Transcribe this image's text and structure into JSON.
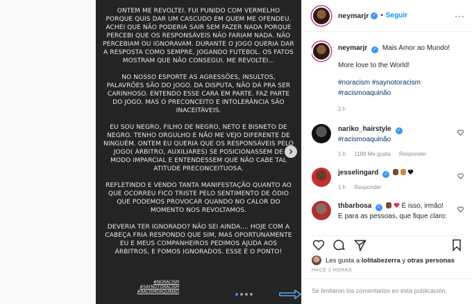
{
  "colors": {
    "accent": "#0095f6",
    "verified": "#3897f0",
    "tag": "#00376b",
    "muted": "#8e8e8e",
    "photo_bg": "#242424"
  },
  "photo": {
    "paragraphs": [
      "ONTEM ME REVOLTEI. FUI PUNIDO COM VERMELHO PORQUE QUIS DAR UM CASCUDO EM QUEM ME OFENDEU. ACHEI QUE NÃO PODERIA SAIR SEM FAZER NADA PORQUE PERCEBI QUE OS RESPONSÁVEIS NÃO FARIAM NADA. NÃO PERCEBIAM OU IGNORAVAM. DURANTE O JOGO QUERIA DAR A RESPOSTA COMO SEMPRE, JOGANDO FUTEBOL. OS FATOS MOSTRAM QUE NÃO CONSEGUI. ME REVOLTEI...",
      "NO NOSSO ESPORTE AS AGRESSÕES, INSULTOS, PALAVRÕES SÃO DO JOGO. DA DISPUTA, NÃO DÁ PRA SER CARINHOSO. ENTENDO ESSE CARA EM PARTE. FAZ PARTE DO JOGO. MAS O PRECONCEITO E INTOLERÂNCIA SÃO INACEITÁVEIS.",
      "EU SOU NEGRO, FILHO DE NEGRO, NETO E BISNETO DE NEGRO. TENHO ORGULHO E NÃO ME VEJO DIFERENTE DE NINGUÉM. ONTEM EU QUERIA QUE OS RESPONSÁVEIS PELO JOGO( ÁRBITRO, AUXILIARES) SE POSICIONASSEM DE MODO IMPARCIAL E ENTENDESSEM QUE NÃO CABE TAL ATITUDE PRECONCEITUOSA.",
      "REFLETINDO E VENDO TANTA MANIFESTAÇÃO QUANTO AO QUE OCORREU FICO TRISTE PELO SENTIMENTO DE ÓDIO QUE PODEMOS PROVOCAR QUANDO NO CALOR DO MOMENTO NOS REVOLTAMOS.",
      "DEVERIA TER IGNORADO? NÃO SEI AINDA.... HOJE COM A CABEÇA FRIA RESPONDO QUE SIM, MAS OPORTUNAMENTE EU E MEUS COMPANHEIROS PEDIMOS AJUDA AOS ÁRBITROS, E FOMOS IGNORADOS. ESSE É O PONTO!"
    ],
    "tags": [
      "#NORACISM",
      "#SAYNOTORACISM",
      "#RACISMOAQUINÃO"
    ]
  },
  "header": {
    "username": "neymarjr",
    "verified": "✓",
    "separator": "•",
    "follow_label": "Seguir",
    "more": "···"
  },
  "caption": {
    "username": "neymarjr",
    "line1": "Mais Amor ao Mundo!",
    "line2": "More love to the World!",
    "tags1": "#noracism #saynotoracism",
    "tags2": "#racismoaquinão",
    "time": "2 h"
  },
  "comments": [
    {
      "username": "nariko_hairstyle",
      "text": "#racismoaquinão",
      "time": "1 h",
      "likes": "1188 Me gusta",
      "reply": "Responder"
    },
    {
      "username": "jesselingard",
      "text": "",
      "time": "1 h",
      "likes": "",
      "reply": "Responder"
    },
    {
      "username": "thbarbosa",
      "text": "É isso, irmão!",
      "text2": "E para as pessoas, que fique claro:",
      "time": "",
      "likes": "",
      "reply": ""
    }
  ],
  "likes": {
    "prefix": "Les gusta a",
    "user": "lolitabezerra",
    "suffix": "y",
    "others": "otras personas"
  },
  "timestamp": "HACE 2 HORAS",
  "footer": {
    "text": "Se limitaron los comentarios en esta publicación."
  }
}
